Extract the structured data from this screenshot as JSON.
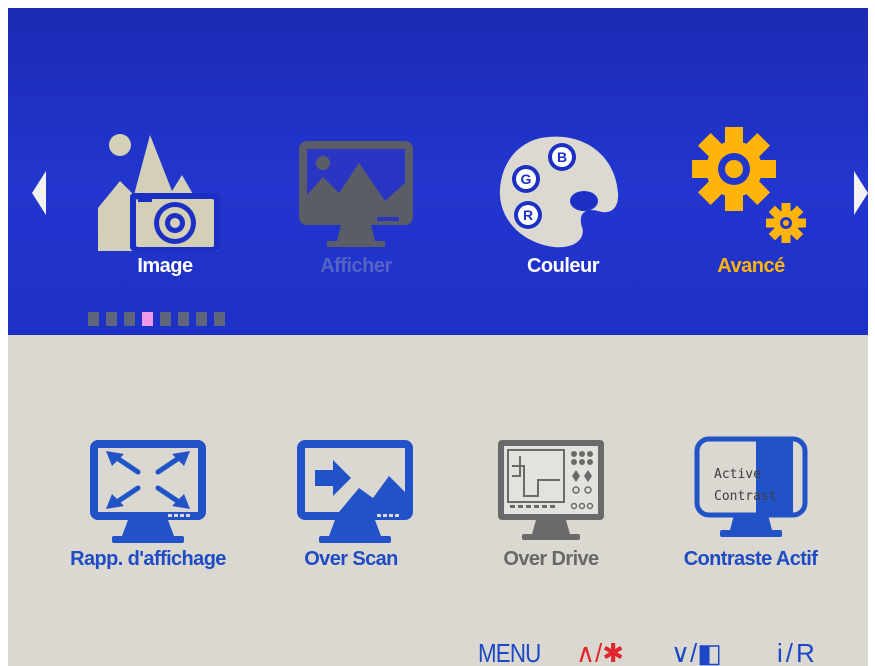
{
  "osd": {
    "nav": {
      "left_arrow_icon": "triangle-left",
      "right_arrow_icon": "triangle-right"
    },
    "tabs": [
      {
        "label": "Image",
        "icon": "mountain-camera-icon",
        "state": "normal",
        "color": "#ffffff"
      },
      {
        "label": "Afficher",
        "icon": "monitor-landscape-icon",
        "state": "disabled",
        "color": "#5562c6"
      },
      {
        "label": "Couleur",
        "icon": "palette-rgb-icon",
        "state": "normal",
        "color": "#ffffff"
      },
      {
        "label": "Avancé",
        "icon": "gears-icon",
        "state": "selected",
        "color": "#ffb40a"
      }
    ],
    "palette_letters": [
      "G",
      "B",
      "R"
    ],
    "page_indicator": {
      "count": 8,
      "active_index": 3,
      "active_color": "#f09ae6"
    },
    "items": [
      {
        "label": "Rapp. d'affichage",
        "icon": "monitor-expand-arrows-icon",
        "color": "#1f4cc4"
      },
      {
        "label": "Over Scan",
        "icon": "monitor-arrow-landscape-icon",
        "color": "#1f4cc4"
      },
      {
        "label": "Over Drive",
        "icon": "monitor-circuit-icon",
        "color": "#686868",
        "state": "disabled"
      },
      {
        "label": "Contraste Actif",
        "icon": "active-contrast-icon",
        "color": "#1f4cc4",
        "icon_text": [
          "Active",
          "Contrast"
        ]
      }
    ],
    "keys": [
      {
        "label": "MENU",
        "color": "#1c48c8"
      },
      {
        "label": "∧/✱",
        "color": "#e0252b"
      },
      {
        "label": "∨/◧",
        "color": "#1c48c8"
      },
      {
        "label": "i/R",
        "color": "#1c48c8"
      }
    ],
    "colors": {
      "top_panel": "#2236cf",
      "bottom_panel": "#dad8d1",
      "accent_selected": "#ffb40a"
    }
  }
}
